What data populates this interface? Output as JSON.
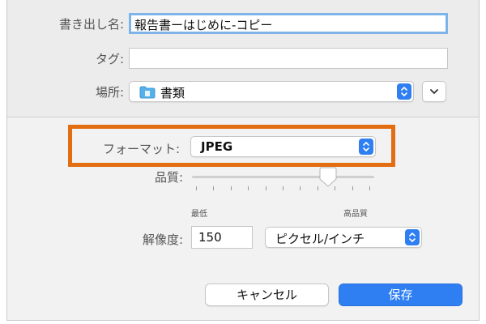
{
  "export": {
    "name_label": "書き出し名:",
    "name_value": "報告書ーはじめに-コピー",
    "tags_label": "タグ:",
    "tags_value": "",
    "location_label": "場所:",
    "location_value": "書類"
  },
  "format": {
    "label": "フォーマット:",
    "value": "JPEG",
    "quality_label": "品質:",
    "quality_min_label": "最低",
    "quality_max_label": "高品質",
    "quality_level": 0.76,
    "quality_ticks": 11,
    "resolution_label": "解像度:",
    "resolution_value": "150",
    "resolution_unit": "ピクセル/インチ"
  },
  "actions": {
    "cancel_label": "キャンセル",
    "save_label": "保存"
  },
  "colors": {
    "accent": "#2f7ff3",
    "highlight": "#e36e12",
    "focus_ring": "#7eb4ea"
  },
  "icons": {
    "folder": "folder-icon",
    "stepper": "updown-stepper-icon",
    "chevron": "chevron-down-icon",
    "slider_knob": "slider-knob-icon"
  }
}
